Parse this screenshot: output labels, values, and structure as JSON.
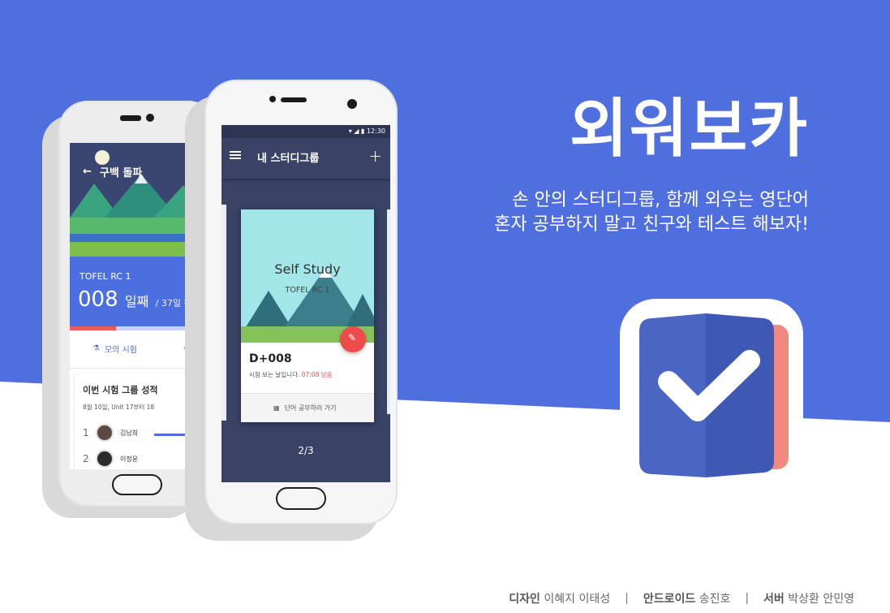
{
  "colors": {
    "brand_blue": "#4F6FDE",
    "accent_red": "#EF4B4B",
    "dark_navy": "#3A4266",
    "white": "#FFFFFF"
  },
  "hero": {
    "title": "외워보카",
    "tagline": [
      "손 안의 스터디그룹, 함께 외우는 영단어",
      "혼자 공부하지 말고 친구와 테스트 해보자!"
    ]
  },
  "logo": {
    "icon": "check-book-icon"
  },
  "back_phone": {
    "header_title": "구백 돌파",
    "course": "TOFEL RC 1",
    "day_value": "008",
    "day_unit": "일째",
    "day_total": "/ 37일 완성",
    "progress_fraction": 0.34,
    "actions": [
      {
        "label": "모의 시험",
        "icon": "flask-icon"
      },
      {
        "label": "시",
        "icon": "pencil-icon"
      }
    ],
    "card": {
      "title": "이번 시험 그룹 성적",
      "subtitle": "8월 10일, Unit 17부터 18",
      "ranks": [
        {
          "rank": "1",
          "name": "김남희"
        },
        {
          "rank": "2",
          "name": "이정윤"
        }
      ]
    }
  },
  "front_phone": {
    "status_time": "12:30",
    "appbar_title": "내 스터디그룹",
    "card": {
      "title": "Self Study",
      "course": "TOFEL RC 1",
      "dday": "D+008",
      "note": "시험 보는 날입니다.",
      "note_time": "07:08 남음",
      "action": "단어 공부하러 가기"
    },
    "pager": "2/3"
  },
  "credits": [
    {
      "role": "디자인",
      "names": "이혜지 이태성"
    },
    {
      "role": "안드로이드",
      "names": "송진호"
    },
    {
      "role": "서버",
      "names": "박상환 안민영"
    }
  ]
}
